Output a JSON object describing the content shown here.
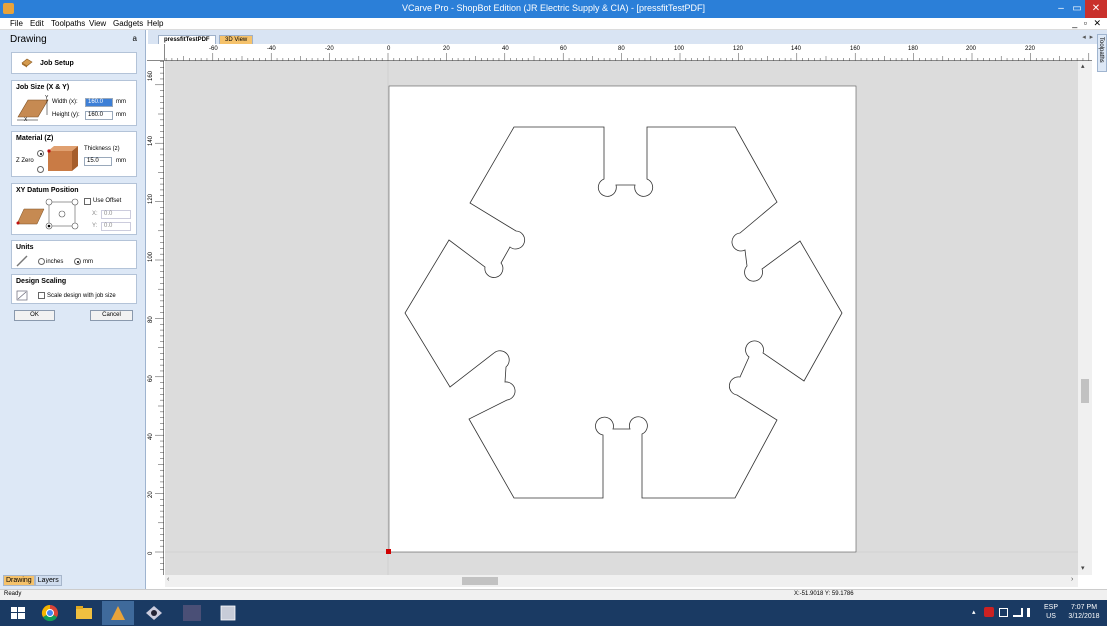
{
  "window": {
    "title": "VCarve Pro - ShopBot Edition (JR Electric Supply & CIA) - [pressfitTestPDF]",
    "minimize_glyph": "–",
    "maximize_glyph": "▭",
    "close_glyph": "✕",
    "mdi_controls": "_ ▫ ✕"
  },
  "menu": [
    "File",
    "Edit",
    "Toolpaths",
    "View",
    "Gadgets",
    "Help"
  ],
  "left_panel": {
    "title": "Drawing",
    "pin_glyph": "a",
    "job_setup_label": "Job Setup",
    "job_size": {
      "title": "Job Size (X & Y)",
      "width_label": "Width (x):",
      "width_value": "160.0",
      "height_label": "Height (y):",
      "height_value": "160.0",
      "unit": "mm",
      "diagram_y": "Y",
      "diagram_x": "X"
    },
    "material": {
      "title": "Material (Z)",
      "zzero_label": "Z Zero",
      "thickness_label": "Thickness (z)",
      "thickness_value": "15.0",
      "unit": "mm"
    },
    "datum": {
      "title": "XY Datum Position",
      "use_offset_label": "Use Offset",
      "x_label": "X:",
      "x_value": "0.0",
      "y_label": "Y:",
      "y_value": "0.0"
    },
    "units": {
      "title": "Units",
      "inches_label": "inches",
      "mm_label": "mm",
      "selected": "mm"
    },
    "scaling": {
      "title": "Design Scaling",
      "scale_label": "Scale design with job size"
    },
    "ok_label": "OK",
    "cancel_label": "Cancel",
    "tabs": [
      "Drawing",
      "Layers"
    ]
  },
  "doc_tabs": [
    "pressfitTestPDF",
    "3D View"
  ],
  "doc_nav": "◂ ▸ ✕",
  "toolpaths_tab": "Toolpaths",
  "rulers": {
    "h_labels": [
      "-60",
      "-40",
      "-20",
      "0",
      "20",
      "40",
      "60",
      "80",
      "100",
      "120",
      "140",
      "160",
      "180",
      "200",
      "220"
    ],
    "v_labels": [
      "160",
      "140",
      "120",
      "100",
      "80",
      "60",
      "40",
      "20",
      "0"
    ]
  },
  "status": {
    "left": "Ready",
    "coords": "X:-51.9018 Y: 59.1786"
  },
  "tray": {
    "lang": "ESP",
    "region": "US",
    "time": "7:07 PM",
    "date": "3/12/2018",
    "expand_glyph": "▴"
  },
  "colors": {
    "titlebar": "#2b7fd8",
    "panel": "#dde8f6",
    "canvas_bg": "#dcdcdc",
    "taskbar": "#1a3a63",
    "active_tab": "#f5c26b"
  }
}
